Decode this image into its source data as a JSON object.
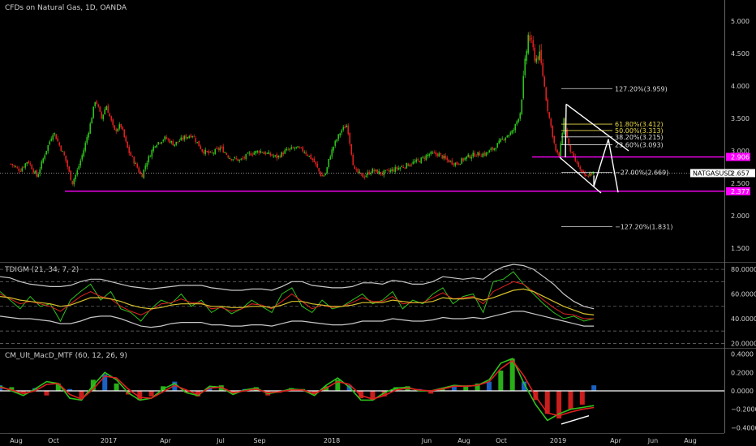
{
  "panels": {
    "price_title": "CFDs on Natural Gas, 1D, OANDA",
    "tdi_title": "TDIGM (21, 34, 7, 2)",
    "macd_title": "CM_Ult_MacD_MTF (60, 12, 26, 9)"
  },
  "colors": {
    "background": "#000000",
    "candle_up": "#2ec21b",
    "candle_down": "#e02020",
    "support_line": "#ff00ff",
    "fib_yellow": "#e8d84a",
    "fib_white": "#dcdcdc",
    "tdi_band": "#c8c8c8",
    "tdi_signal": "#d7c02b",
    "tdi_rsi": "#2ec21b",
    "tdi_fast": "#e02020",
    "macd_zero": "#ffffff"
  },
  "chart_data": [
    {
      "type": "candlestick",
      "panel": "price",
      "title": "CFDs on Natural Gas, 1D, OANDA",
      "ylim": [
        1.3,
        5.1
      ],
      "yticks": [
        "5.000",
        "4.500",
        "4.000",
        "3.500",
        "3.000",
        "2.500",
        "2.000",
        "1.500"
      ],
      "xticks": [
        "Aug",
        "Oct",
        "2017",
        "Apr",
        "Jul",
        "Sep",
        "2018",
        "Jun",
        "Aug",
        "Oct",
        "2019",
        "Apr",
        "Jun",
        "Aug"
      ],
      "price_series": {
        "x": [
          "2016-07-15",
          "2016-08-01",
          "2016-08-15",
          "2016-09-01",
          "2016-09-15",
          "2016-10-01",
          "2016-10-10",
          "2016-10-20",
          "2016-11-01",
          "2016-11-10",
          "2016-11-20",
          "2016-12-01",
          "2016-12-10",
          "2016-12-20",
          "2016-12-28",
          "2017-01-10",
          "2017-01-20",
          "2017-02-01",
          "2017-02-15",
          "2017-02-22",
          "2017-03-01",
          "2017-03-15",
          "2017-04-01",
          "2017-04-15",
          "2017-05-01",
          "2017-05-15",
          "2017-06-01",
          "2017-06-15",
          "2017-07-01",
          "2017-07-15",
          "2017-08-01",
          "2017-08-15",
          "2017-09-01",
          "2017-09-15",
          "2017-10-01",
          "2017-10-15",
          "2017-11-01",
          "2017-11-15",
          "2017-12-01",
          "2017-12-15",
          "2017-12-22",
          "2017-12-28",
          "2018-01-05",
          "2018-01-15",
          "2018-01-25",
          "2018-02-05",
          "2018-02-20",
          "2018-03-05",
          "2018-03-20",
          "2018-04-05",
          "2018-04-20",
          "2018-05-05",
          "2018-05-20",
          "2018-06-05",
          "2018-06-20",
          "2018-07-05",
          "2018-07-20",
          "2018-08-05",
          "2018-08-20",
          "2018-09-05",
          "2018-09-20",
          "2018-10-05",
          "2018-10-20",
          "2018-11-01",
          "2018-11-08",
          "2018-11-14",
          "2018-11-20",
          "2018-11-26",
          "2018-12-01",
          "2018-12-07",
          "2018-12-14",
          "2018-12-20",
          "2018-12-28",
          "2019-01-03",
          "2019-01-10",
          "2019-01-17",
          "2019-01-24",
          "2019-01-31",
          "2019-02-07",
          "2019-02-14",
          "2019-02-21",
          "2019-02-26"
        ],
        "close": [
          2.8,
          2.7,
          2.85,
          2.6,
          2.95,
          3.3,
          3.1,
          2.9,
          2.5,
          2.7,
          3.0,
          3.4,
          3.8,
          3.5,
          3.7,
          3.3,
          3.4,
          3.0,
          2.75,
          2.6,
          2.8,
          3.1,
          3.2,
          3.1,
          3.2,
          3.25,
          3.0,
          2.95,
          3.05,
          2.9,
          2.85,
          2.95,
          3.0,
          2.95,
          2.9,
          3.0,
          3.05,
          3.0,
          2.85,
          2.6,
          2.65,
          2.9,
          3.1,
          3.3,
          3.4,
          2.7,
          2.6,
          2.7,
          2.65,
          2.7,
          2.75,
          2.8,
          2.85,
          2.95,
          2.95,
          2.85,
          2.8,
          2.9,
          2.95,
          2.95,
          3.05,
          3.2,
          3.3,
          3.6,
          4.3,
          4.8,
          4.6,
          4.4,
          4.5,
          4.2,
          3.7,
          3.4,
          3.0,
          2.9,
          3.5,
          3.1,
          2.9,
          2.8,
          2.65,
          2.6,
          2.65,
          2.66
        ]
      },
      "last_price": {
        "label": "NATGASUSD",
        "value": "2.657"
      },
      "horizontal_levels": [
        {
          "price": 2.906,
          "label": "2.906"
        },
        {
          "price": 2.377,
          "label": "2.377"
        }
      ],
      "fibonacci_levels": [
        {
          "label": "127.20%(3.959)",
          "price": 3.959,
          "color": "white"
        },
        {
          "label": "61.80%(3.412)",
          "price": 3.412,
          "color": "yellow"
        },
        {
          "label": "50.00%(3.313)",
          "price": 3.313,
          "color": "yellow"
        },
        {
          "label": "38.20%(3.215)",
          "price": 3.215,
          "color": "white"
        },
        {
          "label": "23.60%(3.093)",
          "price": 3.093,
          "color": "white"
        },
        {
          "label": "−27.00%(2.669)",
          "price": 2.669,
          "color": "white"
        },
        {
          "label": "−127.20%(1.831)",
          "price": 1.831,
          "color": "white"
        }
      ]
    },
    {
      "type": "line",
      "panel": "tdi",
      "title": "TDIGM (21, 34, 7, 2)",
      "ylim": [
        17,
        84
      ],
      "yticks": [
        "80.0000",
        "60.0000",
        "40.0000",
        "20.0000"
      ],
      "levels": [
        80,
        70,
        50,
        30,
        20
      ],
      "series": [
        {
          "values": [
            62,
            55,
            48,
            58,
            50,
            52,
            38,
            55,
            62,
            68,
            55,
            62,
            48,
            45,
            38,
            48,
            55,
            52,
            60,
            50,
            55,
            45,
            50,
            44,
            48,
            55,
            50,
            45,
            60,
            65,
            50,
            45,
            55,
            48,
            50,
            55,
            60,
            52,
            55,
            62,
            48,
            55,
            52,
            60,
            65,
            52,
            58,
            60,
            45,
            70,
            72,
            78,
            68,
            60,
            52,
            45,
            40,
            42,
            38,
            40
          ]
        },
        {
          "values": [
            60,
            56,
            52,
            54,
            52,
            50,
            46,
            52,
            58,
            62,
            58,
            56,
            50,
            46,
            43,
            47,
            52,
            53,
            56,
            53,
            53,
            48,
            49,
            46,
            48,
            52,
            51,
            48,
            54,
            60,
            54,
            48,
            51,
            49,
            50,
            53,
            57,
            54,
            54,
            58,
            52,
            53,
            53,
            57,
            61,
            56,
            57,
            58,
            52,
            62,
            66,
            70,
            68,
            62,
            55,
            49,
            44,
            43,
            40,
            40
          ]
        },
        {
          "values": [
            58,
            57,
            55,
            54,
            53,
            52,
            50,
            51,
            54,
            57,
            57,
            56,
            54,
            51,
            49,
            48,
            49,
            51,
            52,
            52,
            52,
            50,
            50,
            49,
            49,
            50,
            50,
            49,
            51,
            54,
            54,
            52,
            51,
            50,
            50,
            51,
            53,
            53,
            53,
            55,
            54,
            53,
            53,
            54,
            57,
            56,
            56,
            57,
            55,
            57,
            60,
            63,
            64,
            62,
            58,
            54,
            50,
            47,
            44,
            43
          ]
        },
        {
          "values": [
            74,
            73,
            70,
            68,
            67,
            66,
            66,
            67,
            70,
            72,
            72,
            70,
            68,
            66,
            65,
            64,
            65,
            66,
            67,
            67,
            67,
            65,
            64,
            63,
            63,
            64,
            64,
            63,
            66,
            70,
            70,
            67,
            66,
            65,
            65,
            66,
            69,
            69,
            68,
            71,
            70,
            68,
            68,
            70,
            74,
            73,
            72,
            73,
            72,
            78,
            82,
            84,
            83,
            80,
            74,
            68,
            60,
            54,
            50,
            48
          ]
        },
        {
          "values": [
            42,
            41,
            40,
            40,
            39,
            38,
            36,
            36,
            38,
            41,
            42,
            42,
            40,
            37,
            34,
            33,
            34,
            36,
            37,
            37,
            37,
            35,
            35,
            34,
            34,
            35,
            35,
            34,
            36,
            38,
            38,
            37,
            36,
            35,
            35,
            36,
            38,
            38,
            38,
            40,
            39,
            38,
            38,
            39,
            41,
            40,
            40,
            41,
            40,
            42,
            44,
            46,
            46,
            44,
            42,
            40,
            38,
            36,
            34,
            34
          ]
        }
      ]
    },
    {
      "type": "bar",
      "panel": "macd",
      "title": "CM_Ult_MacD_MTF (60, 12, 26, 9)",
      "ylim": [
        -0.44,
        0.44
      ],
      "yticks": [
        "0.4000",
        "0.2000",
        "0.0000",
        "−0.2000",
        "−0.4000"
      ],
      "histogram": [
        0.06,
        0.04,
        -0.02,
        0.03,
        -0.05,
        0.08,
        0.02,
        -0.08,
        0.12,
        0.18,
        0.08,
        -0.04,
        -0.1,
        -0.06,
        0.05,
        0.1,
        -0.02,
        -0.06,
        0.04,
        0.06,
        -0.03,
        0.02,
        0.04,
        -0.05,
        -0.02,
        0.03,
        0.02,
        -0.04,
        0.05,
        0.12,
        0.06,
        -0.08,
        -0.1,
        -0.06,
        0.04,
        0.05,
        0.02,
        -0.03,
        0.02,
        0.05,
        0.06,
        0.08,
        0.1,
        0.22,
        0.35,
        0.1,
        -0.1,
        -0.25,
        -0.3,
        -0.2,
        -0.15,
        0.06
      ],
      "series": [
        {
          "values": [
            0.05,
            0.0,
            -0.05,
            0.02,
            0.1,
            0.08,
            -0.08,
            -0.1,
            0.06,
            0.2,
            0.12,
            -0.02,
            -0.1,
            -0.08,
            0.02,
            0.08,
            -0.02,
            -0.05,
            0.05,
            0.04,
            -0.04,
            0.01,
            0.03,
            -0.03,
            -0.01,
            0.02,
            0.01,
            -0.05,
            0.06,
            0.14,
            0.04,
            -0.1,
            -0.1,
            -0.02,
            0.03,
            0.04,
            0.0,
            0.0,
            0.03,
            0.06,
            0.05,
            0.06,
            0.12,
            0.3,
            0.35,
            0.08,
            -0.15,
            -0.32,
            -0.25,
            -0.2,
            -0.18,
            -0.16
          ]
        },
        {
          "values": [
            0.04,
            0.01,
            -0.03,
            0.0,
            0.07,
            0.08,
            -0.04,
            -0.09,
            0.02,
            0.16,
            0.14,
            0.02,
            -0.07,
            -0.08,
            -0.01,
            0.06,
            0.01,
            -0.04,
            0.03,
            0.04,
            -0.02,
            0.0,
            0.02,
            -0.02,
            -0.01,
            0.01,
            0.01,
            -0.03,
            0.03,
            0.1,
            0.07,
            -0.05,
            -0.09,
            -0.05,
            0.01,
            0.03,
            0.01,
            0.0,
            0.02,
            0.05,
            0.05,
            0.06,
            0.1,
            0.24,
            0.33,
            0.16,
            -0.06,
            -0.24,
            -0.27,
            -0.23,
            -0.2,
            -0.18
          ]
        }
      ]
    }
  ]
}
